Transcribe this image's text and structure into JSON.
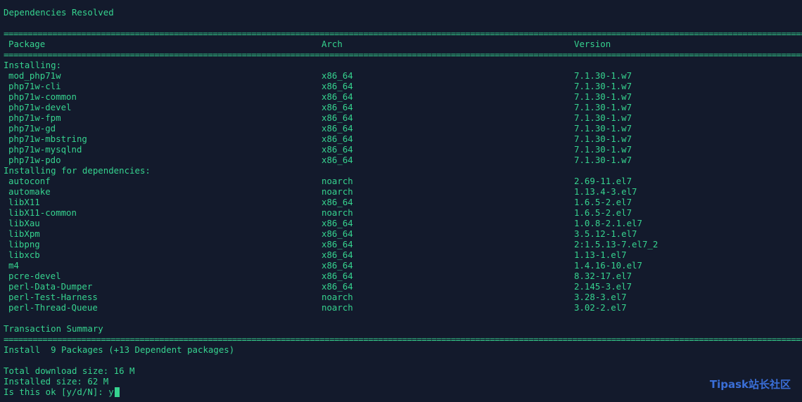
{
  "terminal": {
    "heading": "Dependencies Resolved",
    "rule_char": "=",
    "columns": {
      "package": "Package",
      "arch": "Arch",
      "version": "Version"
    },
    "groups": [
      {
        "label": "Installing:",
        "packages": [
          {
            "name": "mod_php71w",
            "arch": "x86_64",
            "version": "7.1.30-1.w7"
          },
          {
            "name": "php71w-cli",
            "arch": "x86_64",
            "version": "7.1.30-1.w7"
          },
          {
            "name": "php71w-common",
            "arch": "x86_64",
            "version": "7.1.30-1.w7"
          },
          {
            "name": "php71w-devel",
            "arch": "x86_64",
            "version": "7.1.30-1.w7"
          },
          {
            "name": "php71w-fpm",
            "arch": "x86_64",
            "version": "7.1.30-1.w7"
          },
          {
            "name": "php71w-gd",
            "arch": "x86_64",
            "version": "7.1.30-1.w7"
          },
          {
            "name": "php71w-mbstring",
            "arch": "x86_64",
            "version": "7.1.30-1.w7"
          },
          {
            "name": "php71w-mysqlnd",
            "arch": "x86_64",
            "version": "7.1.30-1.w7"
          },
          {
            "name": "php71w-pdo",
            "arch": "x86_64",
            "version": "7.1.30-1.w7"
          }
        ]
      },
      {
        "label": "Installing for dependencies:",
        "packages": [
          {
            "name": "autoconf",
            "arch": "noarch",
            "version": "2.69-11.el7"
          },
          {
            "name": "automake",
            "arch": "noarch",
            "version": "1.13.4-3.el7"
          },
          {
            "name": "libX11",
            "arch": "x86_64",
            "version": "1.6.5-2.el7"
          },
          {
            "name": "libX11-common",
            "arch": "noarch",
            "version": "1.6.5-2.el7"
          },
          {
            "name": "libXau",
            "arch": "x86_64",
            "version": "1.0.8-2.1.el7"
          },
          {
            "name": "libXpm",
            "arch": "x86_64",
            "version": "3.5.12-1.el7"
          },
          {
            "name": "libpng",
            "arch": "x86_64",
            "version": "2:1.5.13-7.el7_2"
          },
          {
            "name": "libxcb",
            "arch": "x86_64",
            "version": "1.13-1.el7"
          },
          {
            "name": "m4",
            "arch": "x86_64",
            "version": "1.4.16-10.el7"
          },
          {
            "name": "pcre-devel",
            "arch": "x86_64",
            "version": "8.32-17.el7"
          },
          {
            "name": "perl-Data-Dumper",
            "arch": "x86_64",
            "version": "2.145-3.el7"
          },
          {
            "name": "perl-Test-Harness",
            "arch": "noarch",
            "version": "3.28-3.el7"
          },
          {
            "name": "perl-Thread-Queue",
            "arch": "noarch",
            "version": "3.02-2.el7"
          }
        ]
      }
    ],
    "summary_heading": "Transaction Summary",
    "install_line": "Install  9 Packages (+13 Dependent packages)",
    "download_size": "Total download size: 16 M",
    "installed_size": "Installed size: 62 M",
    "prompt": "Is this ok [y/d/N]: ",
    "prompt_input": "y",
    "text_color": "#36d38f",
    "background_color": "#131a2c"
  },
  "watermark": {
    "text": "Tipask站长社区",
    "color": "#3a6fd8"
  }
}
